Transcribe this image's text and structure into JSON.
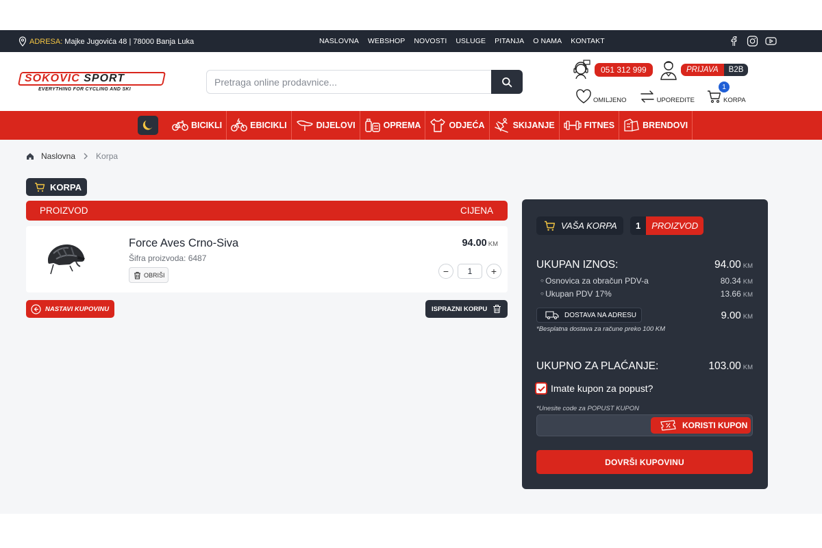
{
  "topbar": {
    "address_label": "ADRESA:",
    "address": "Majke Jugovića 48 | 78000 Banja Luka",
    "nav": [
      "NASLOVNA",
      "WEBSHOP",
      "NOVOSTI",
      "USLUGE",
      "PITANJA",
      "O NAMA",
      "KONTAKT"
    ],
    "social_icons": [
      "facebook-icon",
      "instagram-icon",
      "youtube-icon"
    ]
  },
  "header": {
    "logo_text_1": "SOKOVIĆ",
    "logo_text_2": "SPORT",
    "logo_tagline": "EVERYTHING FOR CYCLING AND SKI",
    "search_placeholder": "Pretraga online prodavnice...",
    "phone": "051 312 999",
    "login_label": "PRIJAVA",
    "b2b_label": "B2B",
    "favorites_label": "OMILJENO",
    "compare_label": "UPOREDITE",
    "cart_label": "KORPA",
    "cart_count": "1"
  },
  "categories": [
    "BICIKLI",
    "EBICIKLI",
    "DIJELOVI",
    "OPREMA",
    "ODJEĆA",
    "SKIJANJE",
    "FITNES",
    "BRENDOVI"
  ],
  "breadcrumb": {
    "home": "Naslovna",
    "current": "Korpa"
  },
  "cart": {
    "section_title": "KORPA",
    "col_product": "PROIZVOD",
    "col_price": "CIJENA",
    "items": [
      {
        "name": "Force Aves Crno-Siva",
        "sku": "Šifra proizvoda: 6487",
        "delete_label": "OBRIŠI",
        "price": "94.00",
        "currency": "KM",
        "quantity": "1"
      }
    ],
    "continue_label": "NASTAVI KUPOVINU",
    "empty_label": "ISPRAZNI KORPU"
  },
  "summary": {
    "cart_label": "VAŠA KORPA",
    "count": "1",
    "count_label": "PROIZVOD",
    "total_label": "UKUPAN IZNOS:",
    "total_value": "94.00",
    "base_label": "Osnovica za obračun PDV-a",
    "base_value": "80.34",
    "vat_label": "Ukupan PDV 17%",
    "vat_value": "13.66",
    "delivery_label": "DOSTAVA NA ADRESU",
    "delivery_value": "9.00",
    "free_note": "*Besplatna dostava za račune preko 100 KM",
    "pay_label": "UKUPNO ZA PLAĆANJE:",
    "pay_value": "103.00",
    "currency": "KM",
    "coupon_question": "Imate kupon za popust?",
    "coupon_checked": true,
    "coupon_note": "*Unesite code za POPUST KUPON",
    "coupon_value": "",
    "coupon_button": "KORISTI KUPON",
    "finish_button": "DOVRŠI KUPOVINU"
  },
  "colors": {
    "brand_red": "#d9261c",
    "dark": "#2a303b",
    "topbar": "#222833",
    "badge_blue": "#1f5fd6"
  }
}
